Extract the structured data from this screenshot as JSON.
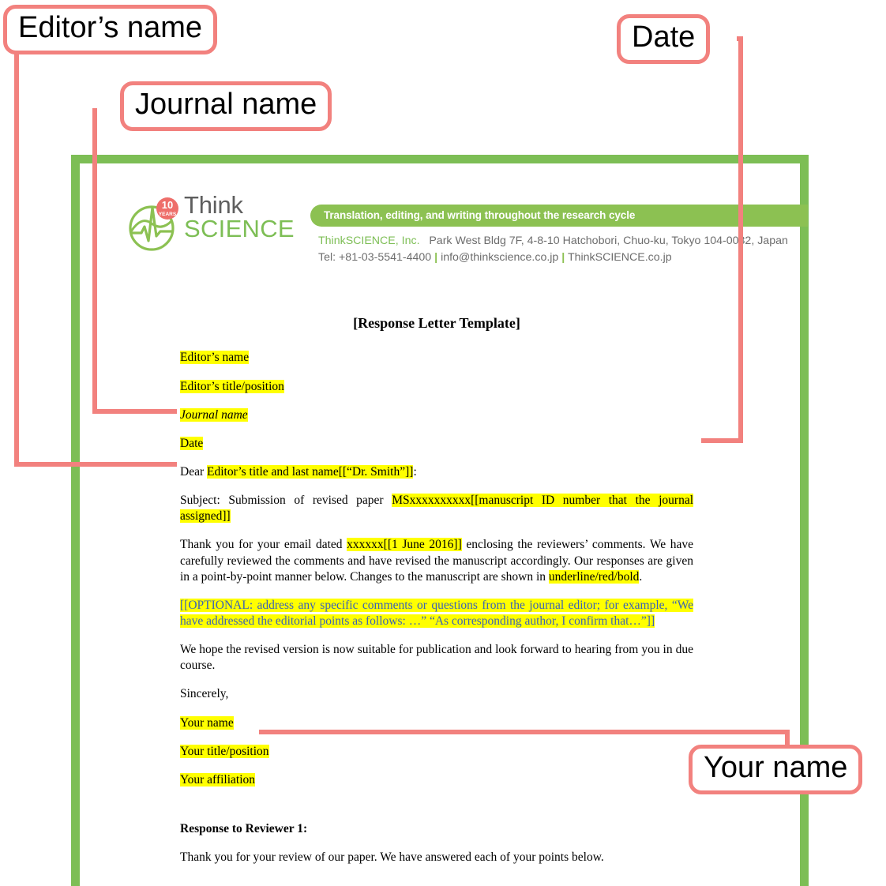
{
  "colors": {
    "coral": "#F2817E",
    "green_frame": "#7DBE55",
    "green_bar": "#8CC152",
    "highlight": "#FFFF00",
    "blue_text": "#3B63B5",
    "badge_red": "#EE6E6A"
  },
  "letterhead": {
    "logo": {
      "badge_number": "10",
      "badge_label": "YEARS",
      "word_top": "Think",
      "word_bottom": "SCIENCE"
    },
    "tagline": "Translation, editing, and writing throughout the research cycle",
    "company": "ThinkSCIENCE, Inc.",
    "address": "Park West Bldg 7F, 4-8-10 Hatchobori, Chuo-ku, Tokyo 104-0032, Japan",
    "tel": "Tel: +81-03-5541-4400",
    "separator": "|",
    "email": "info@thinkscience.co.jp",
    "website": "ThinkSCIENCE.co.jp"
  },
  "letter": {
    "title": "[Response Letter Template]",
    "editor_name": "Editor’s name",
    "editor_title": "Editor’s title/position",
    "journal_name": "Journal name",
    "date": "Date",
    "salutation_prefix": "Dear ",
    "salutation_field": "Editor’s title and last name[[“Dr. Smith”]]",
    "salutation_suffix": ":",
    "subject_prefix": "Subject: Submission of revised paper ",
    "subject_field": "MSxxxxxxxxxx[[manuscript ID number that the journal assigned]]",
    "para1_a": "Thank you for your email dated ",
    "para1_field1": "xxxxxx[[1 June 2016]]",
    "para1_b": " enclosing the reviewers’ comments. We have carefully reviewed the comments and have revised the manuscript accordingly. Our responses are given in a point-by-point manner below. Changes to the manuscript are shown in ",
    "para1_field2": "underline/red/bold",
    "para1_c": ".",
    "optional_para": "[[OPTIONAL: address any specific comments or questions from the journal editor; for example, “We have addressed the editorial points as follows: …” “As corresponding author, I confirm that…”]]",
    "closing_para": "We hope the revised version is now suitable for publication and look forward to hearing from you in due course.",
    "sincerely": "Sincerely,",
    "your_name": "Your name",
    "your_title": "Your title/position",
    "your_affiliation": "Your affiliation",
    "reviewer_heading": "Response to Reviewer 1:",
    "reviewer_para": "Thank you for your review of our paper. We have answered each of your points below."
  },
  "callouts": {
    "editor_name": "Editor’s name",
    "journal_name": "Journal name",
    "date": "Date",
    "your_name": "Your name"
  }
}
